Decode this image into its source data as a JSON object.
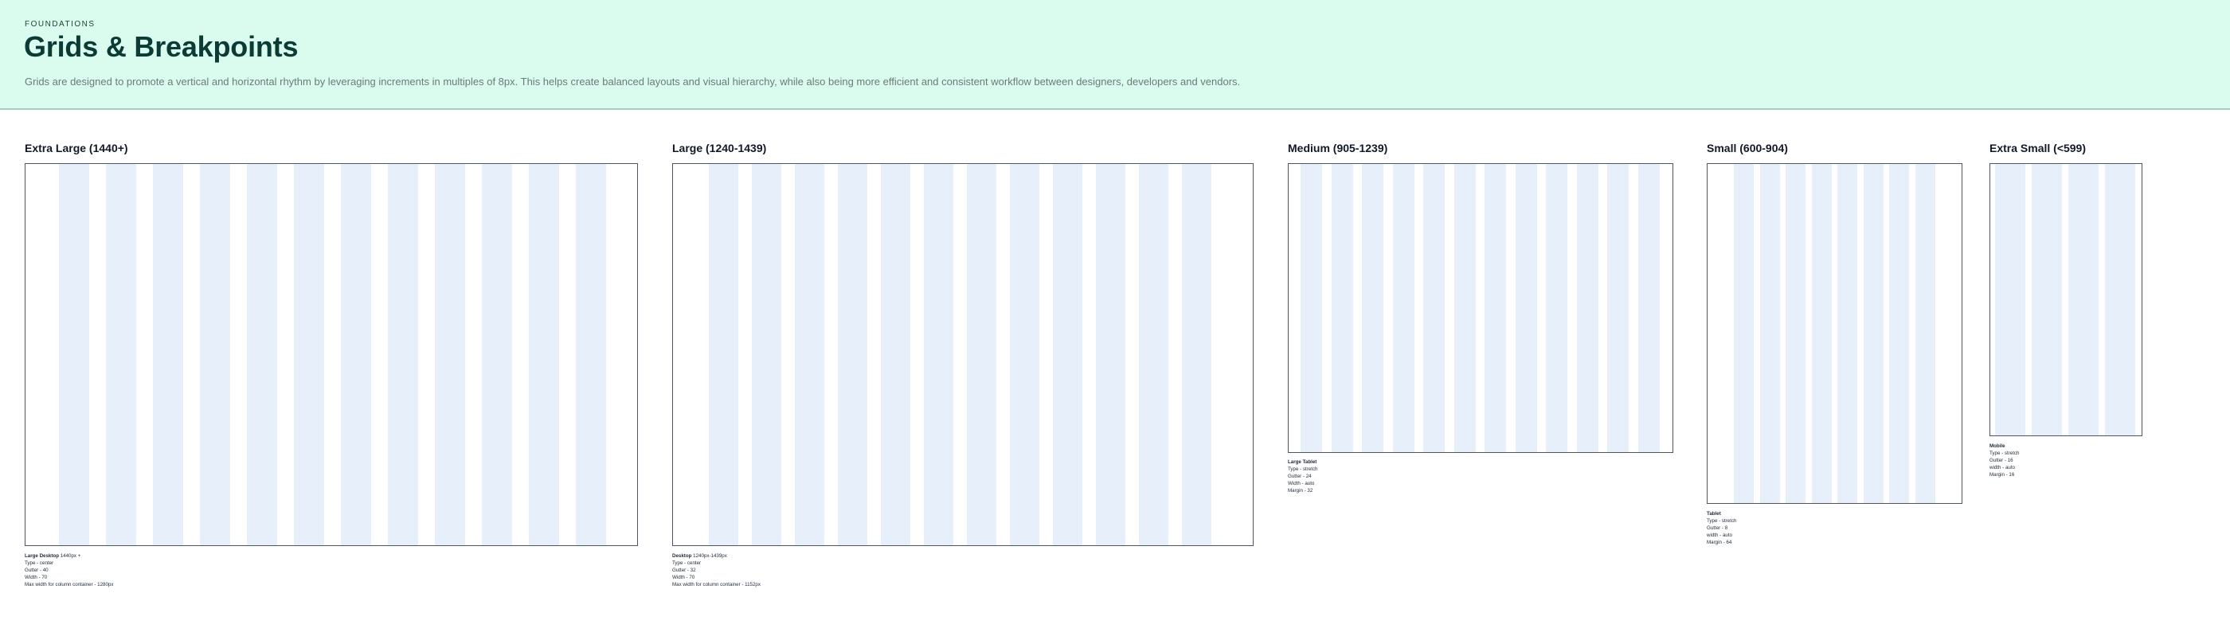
{
  "header": {
    "eyebrow": "FOUNDATIONS",
    "title": "Grids & Breakpoints",
    "description": "Grids are designed to promote a vertical and horizontal rhythm by leveraging increments in multiples of 8px. This helps create balanced layouts and visual hierarchy, while also being more efficient and consistent workflow between designers, developers and vendors."
  },
  "breakpoints": [
    {
      "title": "Extra Large (1440+)",
      "columns": 12,
      "notes": {
        "name": "Large Desktop",
        "range": "1440px +",
        "lines": [
          "Type - center",
          "Gutter - 40",
          "Width - 70",
          "Max width for column container - 1280px"
        ]
      }
    },
    {
      "title": "Large (1240-1439)",
      "columns": 12,
      "notes": {
        "name": "Desktop",
        "range": "1240px-1439px",
        "lines": [
          "Type - center",
          "Gutter - 32",
          "Width - 70",
          "Max width for column container - 1152px"
        ]
      }
    },
    {
      "title": "Medium (905-1239)",
      "columns": 12,
      "notes": {
        "name": "Large Tablet",
        "range": "",
        "lines": [
          "Type - stretch",
          "Gutter - 24",
          "Width - auto",
          "Margin - 32"
        ]
      }
    },
    {
      "title": "Small (600-904)",
      "columns": 8,
      "notes": {
        "name": "Tablet",
        "range": "",
        "lines": [
          "Type - stretch",
          "Gutter - 8",
          "width - auto",
          "Margin - 64"
        ]
      }
    },
    {
      "title": "Extra Small (<599)",
      "columns": 4,
      "notes": {
        "name": "Mobile",
        "range": "",
        "lines": [
          "Type - stretch",
          "Gutter - 16",
          "width - auto",
          "Margin - 16"
        ]
      }
    }
  ]
}
